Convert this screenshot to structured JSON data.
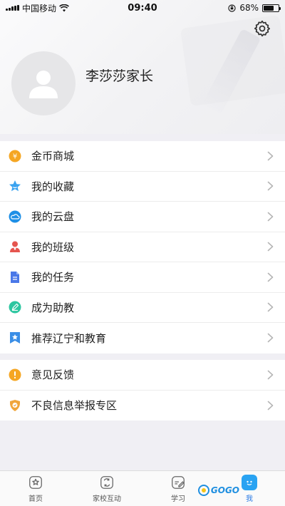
{
  "status_bar": {
    "carrier": "中国移动",
    "time": "09:40",
    "battery": "68%",
    "battery_level": 0.68
  },
  "profile": {
    "username": "李莎莎家长"
  },
  "menu_group_1": [
    {
      "label": "金币商城",
      "icon": "coin-icon",
      "color": "#f5a623"
    },
    {
      "label": "我的收藏",
      "icon": "star-icon",
      "color": "#3aa3f0"
    },
    {
      "label": "我的云盘",
      "icon": "cloud-icon",
      "color": "#1e8fe6"
    },
    {
      "label": "我的班级",
      "icon": "person-icon",
      "color": "#e5554f"
    },
    {
      "label": "我的任务",
      "icon": "document-icon",
      "color": "#4a78e8"
    },
    {
      "label": "成为助教",
      "icon": "pencil-icon",
      "color": "#2cc6a0"
    },
    {
      "label": "推荐辽宁和教育",
      "icon": "bookmark-star-icon",
      "color": "#3a8ee6"
    }
  ],
  "menu_group_2": [
    {
      "label": "意见反馈",
      "icon": "exclamation-icon",
      "color": "#f5a623"
    },
    {
      "label": "不良信息举报专区",
      "icon": "badge-icon",
      "color": "#f0a53a"
    }
  ],
  "tab_bar": {
    "tabs": [
      {
        "label": "首页",
        "icon": "home-star-icon"
      },
      {
        "label": "家校互动",
        "icon": "interaction-icon"
      },
      {
        "label": "学习",
        "icon": "study-icon"
      },
      {
        "label": "我",
        "icon": "me-icon"
      }
    ],
    "active": "我",
    "watermark": "GOGO"
  }
}
